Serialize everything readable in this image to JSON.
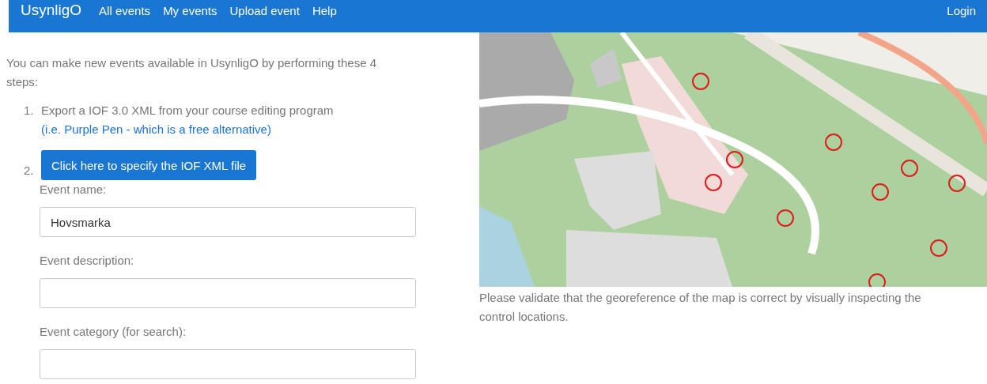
{
  "navbar": {
    "brand": "UsynligO",
    "links": [
      "All events",
      "My events",
      "Upload event",
      "Help"
    ],
    "login": "Login"
  },
  "intro": "You can make new events available in UsynligO by performing these 4 steps:",
  "steps": [
    {
      "number": "1.",
      "text": "Export a IOF 3.0 XML from your course editing program",
      "link": "(i.e. Purple Pen - which is a free alternative)"
    },
    {
      "number": "2.",
      "button": "Click here to specify the IOF XML file"
    }
  ],
  "fields": [
    {
      "label": "Event name:",
      "value": "Hovsmarka"
    },
    {
      "label": "Event description:"
    },
    {
      "label": "Event category (for search):"
    }
  ],
  "map": {
    "kind": "picture",
    "caption": "Please validate that the georeference of the map is correct by visually inspecting the control locations."
  }
}
